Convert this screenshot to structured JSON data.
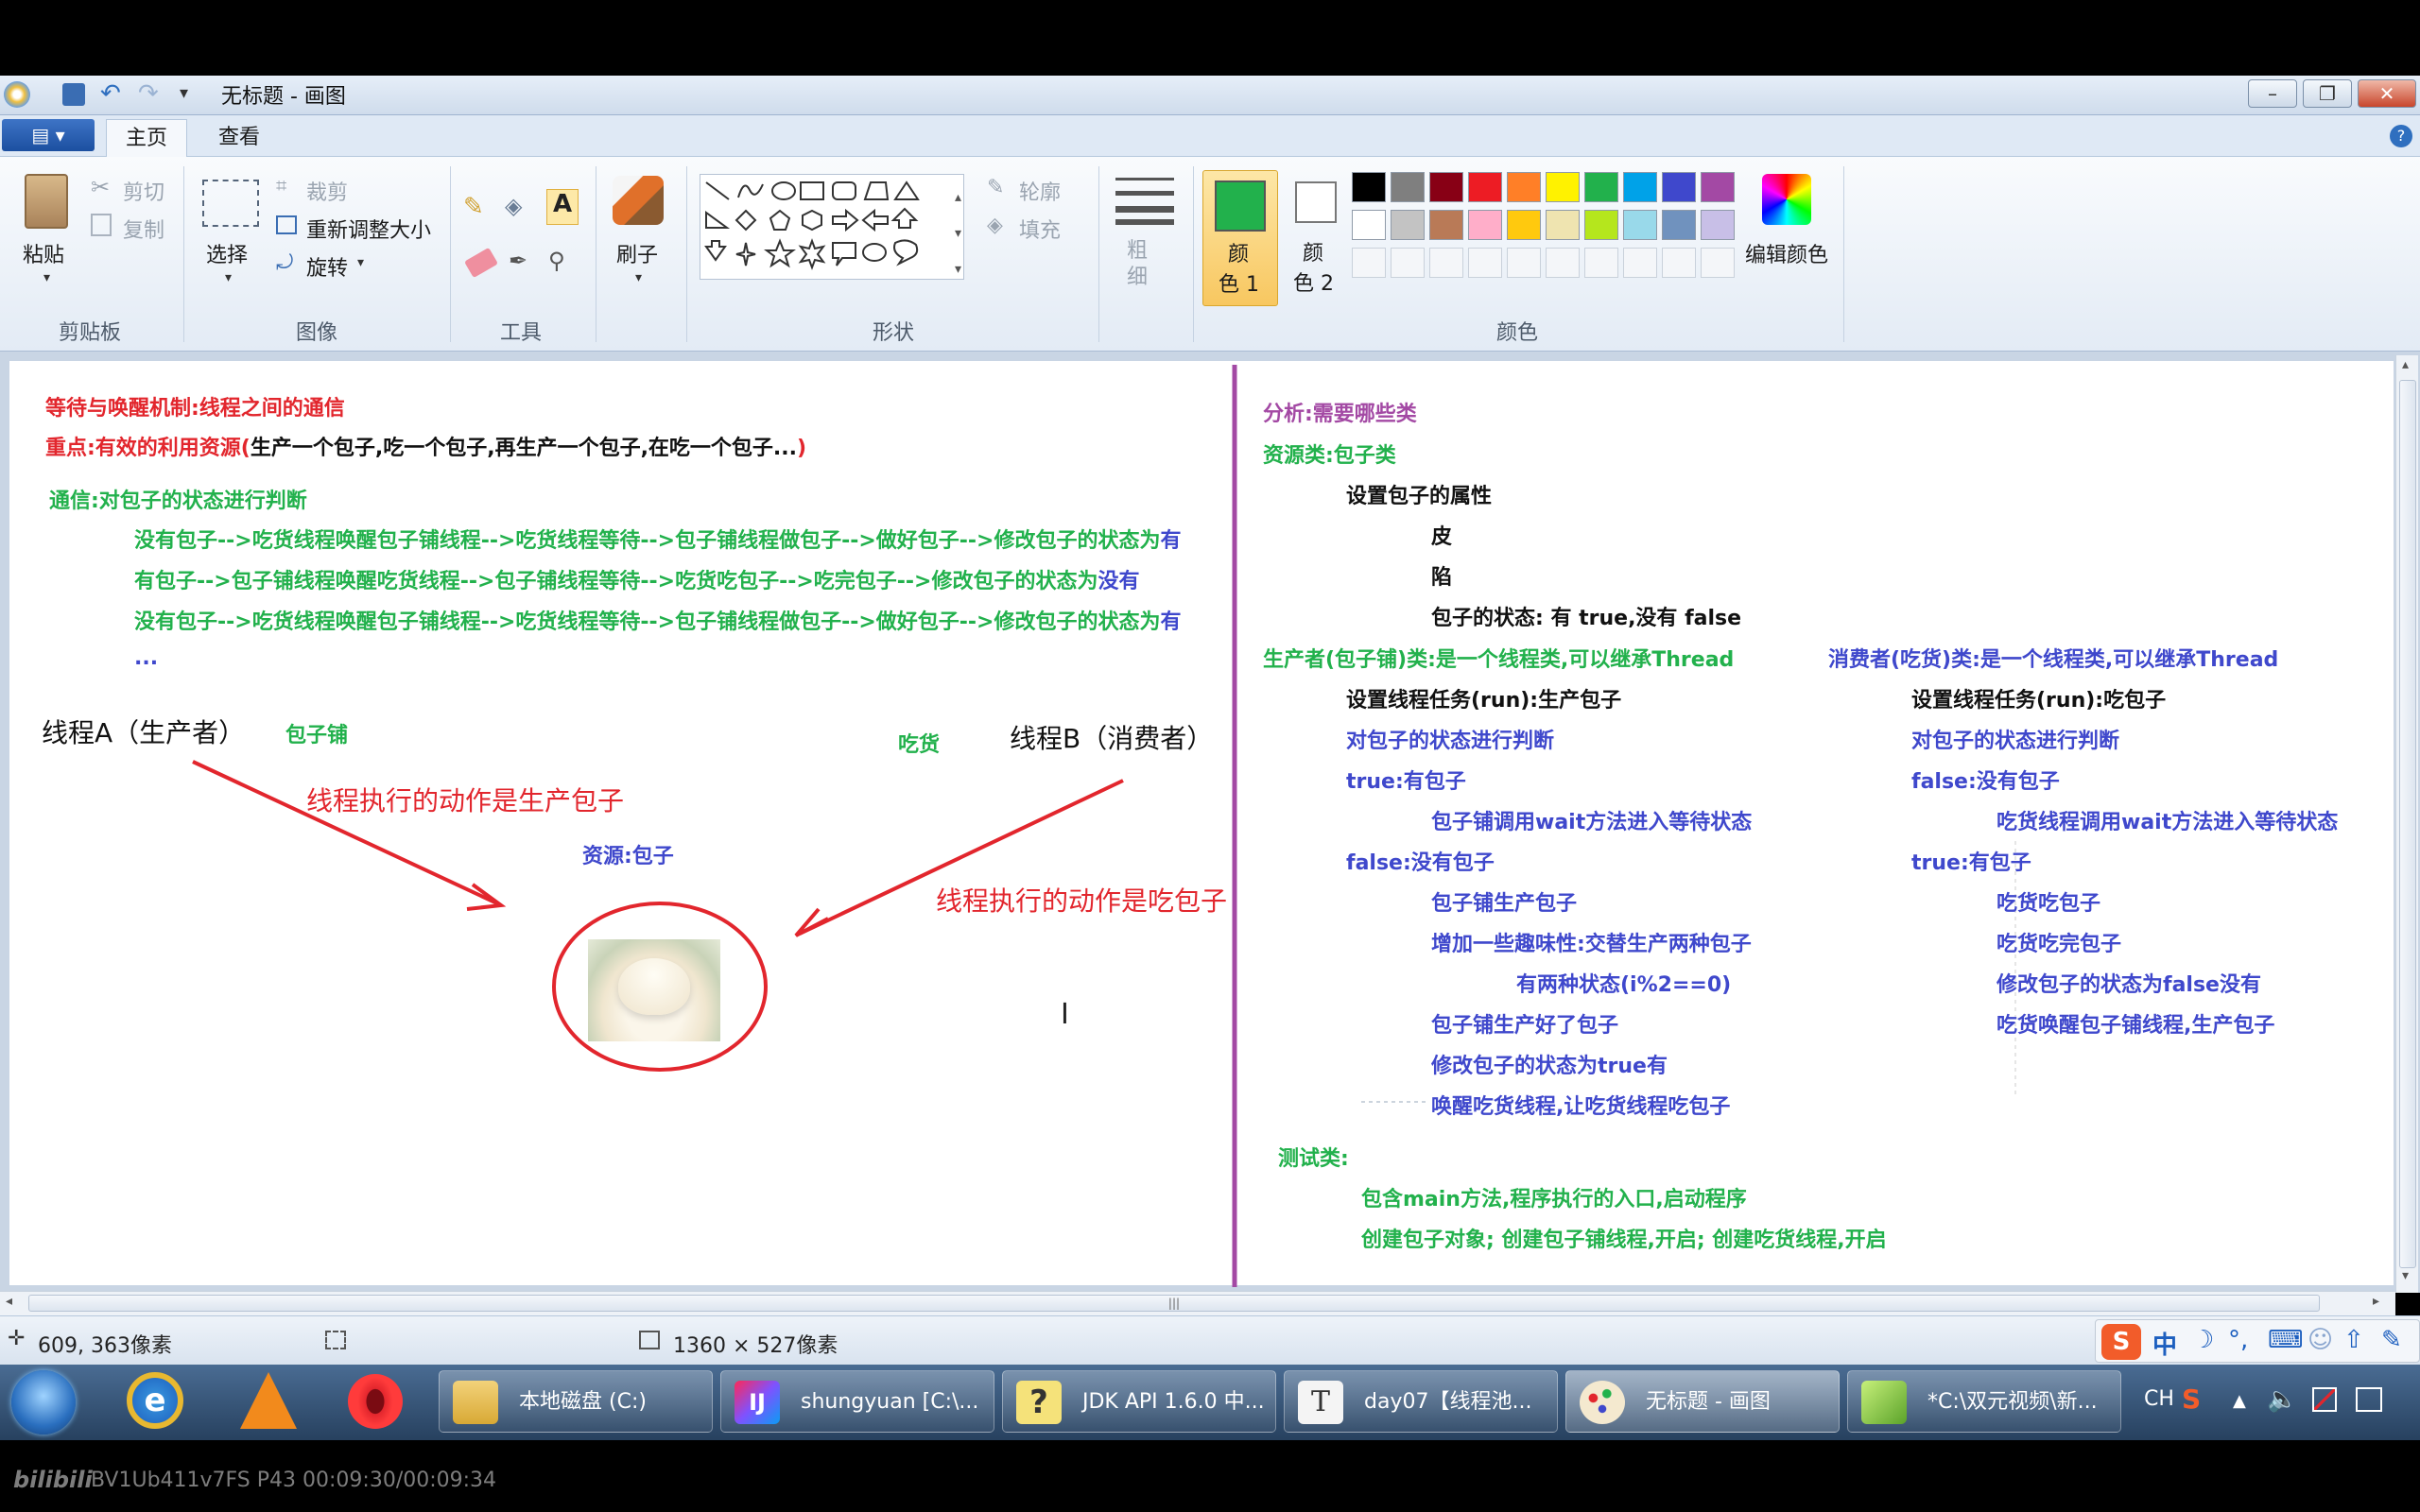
{
  "window": {
    "title": "无标题 - 画图"
  },
  "menu": {
    "tabs": [
      "主页",
      "查看"
    ]
  },
  "ribbon": {
    "clipboard": {
      "paste": "粘贴",
      "cut": "剪切",
      "copy": "复制",
      "label": "剪贴板"
    },
    "image": {
      "select": "选择",
      "crop": "裁剪",
      "resize": "重新调整大小",
      "rotate": "旋转",
      "label": "图像"
    },
    "tools": {
      "label": "工具"
    },
    "brush": {
      "label": "刷子"
    },
    "shapes": {
      "outline": "轮廓",
      "fill": "填充",
      "label": "形状"
    },
    "size": {
      "label": "粗细"
    },
    "color1": {
      "label": "颜色 1",
      "l1": "颜",
      "l2": "色 1"
    },
    "color2": {
      "label": "颜色 2",
      "l1": "颜",
      "l2": "色 2"
    },
    "colors": {
      "label": "颜色",
      "edit": "编辑颜色"
    },
    "palette_row1": [
      "#000000",
      "#7f7f7f",
      "#880015",
      "#ed1c24",
      "#ff7f27",
      "#fff200",
      "#22b14c",
      "#00a2e8",
      "#3f48cc",
      "#a349a4"
    ],
    "palette_row2": [
      "#ffffff",
      "#c3c3c3",
      "#b97a57",
      "#ffaec9",
      "#ffc90e",
      "#efe4b0",
      "#b5e61d",
      "#99d9ea",
      "#7092be",
      "#c8bfe7"
    ],
    "active_color": "#22b14c"
  },
  "canvas": {
    "left": {
      "l1": "等待与唤醒机制:线程之间的通信",
      "l2a": "重点:有效的利用资源(",
      "l2b": "生产一个包子,吃一个包子,再生产一个包子,在吃一个包子...",
      "l2c": ")",
      "l3": "通信:对包子的状态进行判断",
      "l4a": "没有包子-->吃货线程唤醒包子铺线程-->吃货线程等待-->包子铺线程做包子-->做好包子-->修改包子的状态为",
      "l4b": "有",
      "l5a": "有包子-->包子铺线程唤醒吃货线程-->包子铺线程等待-->吃货吃包子-->吃完包子-->修改包子的状态为",
      "l5b": "没有",
      "l6a": "没有包子-->吃货线程唤醒包子铺线程-->吃货线程等待-->包子铺线程做包子-->做好包子-->修改包子的状态为",
      "l6b": "有",
      "l7": "...",
      "threadA": "线程A（生产者）",
      "baozipu": "包子铺",
      "chihuo": "吃货",
      "threadB": "线程B（消费者）",
      "actionA": "线程执行的动作是生产包子",
      "resource": "资源:包子",
      "actionB": "线程执行的动作是吃包子"
    },
    "right": {
      "r1": "分析:需要哪些类",
      "r2": "资源类:包子类",
      "r3": "设置包子的属性",
      "r4": "皮",
      "r5": "陷",
      "r6": "包子的状态: 有 true,没有 false",
      "p0": "生产者(包子铺)类:是一个线程类,可以继承Thread",
      "p1": "设置线程任务(run):生产包子",
      "p2": "对包子的状态进行判断",
      "p3": "true:有包子",
      "p4": "包子铺调用wait方法进入等待状态",
      "p5": "false:没有包子",
      "p6": "包子铺生产包子",
      "p7": "增加一些趣味性:交替生产两种包子",
      "p8": "有两种状态(i%2==0)",
      "p9": "包子铺生产好了包子",
      "p10": "修改包子的状态为true有",
      "p11": "唤醒吃货线程,让吃货线程吃包子",
      "c0": "消费者(吃货)类:是一个线程类,可以继承Thread",
      "c1": "设置线程任务(run):吃包子",
      "c2": "对包子的状态进行判断",
      "c3": "false:没有包子",
      "c4": "吃货线程调用wait方法进入等待状态",
      "c5": "true:有包子",
      "c6": "吃货吃包子",
      "c7": "吃货吃完包子",
      "c8": "修改包子的状态为false没有",
      "c9": "吃货唤醒包子铺线程,生产包子",
      "t0": "测试类:",
      "t1": "包含main方法,程序执行的入口,启动程序",
      "t2": "创建包子对象; 创建包子铺线程,开启; 创建吃货线程,开启"
    }
  },
  "status": {
    "cursor": "609, 363像素",
    "size": "1360 × 527像素"
  },
  "taskbar": {
    "items": [
      "本地磁盘 (C:)",
      "shungyuan [C:\\...",
      "JDK API 1.6.0 中...",
      "day07【线程池...",
      "无标题 - 画图",
      "*C:\\双元视频\\新..."
    ],
    "lang": "CH"
  },
  "watermark": "BV1Ub411v7FS P43 00:09:30/00:09:34"
}
